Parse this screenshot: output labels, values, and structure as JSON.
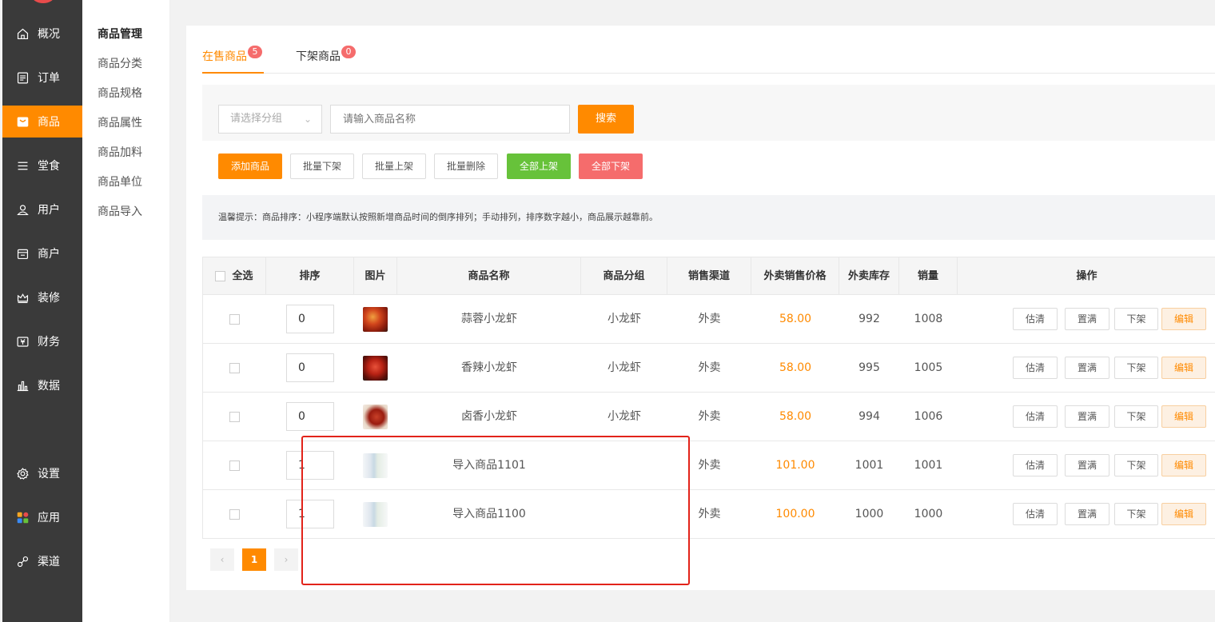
{
  "nav": {
    "items": [
      {
        "label": "概况",
        "icon": "home-icon"
      },
      {
        "label": "订单",
        "icon": "order-list-icon"
      },
      {
        "label": "商品",
        "icon": "shop-bag-icon"
      },
      {
        "label": "堂食",
        "icon": "menu-lines-icon"
      },
      {
        "label": "用户",
        "icon": "user-icon"
      },
      {
        "label": "商户",
        "icon": "store-icon"
      },
      {
        "label": "装修",
        "icon": "crown-icon"
      },
      {
        "label": "财务",
        "icon": "finance-icon"
      },
      {
        "label": "数据",
        "icon": "bar-chart-icon"
      },
      {
        "label": "设置",
        "icon": "gear-icon"
      },
      {
        "label": "应用",
        "icon": "apps-icon"
      },
      {
        "label": "渠道",
        "icon": "channel-icon"
      }
    ],
    "active": "商品",
    "accent": "#ff8a00"
  },
  "submenu": {
    "items": [
      "商品管理",
      "商品分类",
      "商品规格",
      "商品属性",
      "商品加料",
      "商品单位",
      "商品导入"
    ],
    "active": "商品管理"
  },
  "tabs": [
    {
      "label": "在售商品",
      "badge": "5",
      "active": true
    },
    {
      "label": "下架商品",
      "badge": "0",
      "active": false
    }
  ],
  "filter": {
    "group_placeholder": "请选择分组",
    "name_placeholder": "请输入商品名称",
    "search_label": "搜索"
  },
  "actions": {
    "add": "添加商品",
    "batch_off": "批量下架",
    "batch_on": "批量上架",
    "batch_delete": "批量删除",
    "all_on": "全部上架",
    "all_off": "全部下架"
  },
  "tip": "温馨提示：商品排序：小程序端默认按照新增商品时间的倒序排列；手动排列，排序数字越小，商品展示越靠前。",
  "table": {
    "headers": {
      "select_all": "全选",
      "sort": "排序",
      "image": "图片",
      "name": "商品名称",
      "group": "商品分组",
      "channel": "销售渠道",
      "price": "外卖销售价格",
      "stock": "外卖库存",
      "sales": "销量",
      "ops": "操作"
    },
    "rows": [
      {
        "sort": "0",
        "image": "crayfish-garlic-photo",
        "name": "蒜蓉小龙虾",
        "group": "小龙虾",
        "channel": "外卖",
        "price": "58.00",
        "stock": "992",
        "sales": "1008"
      },
      {
        "sort": "0",
        "image": "crayfish-spicy-photo",
        "name": "香辣小龙虾",
        "group": "小龙虾",
        "channel": "外卖",
        "price": "58.00",
        "stock": "995",
        "sales": "1005"
      },
      {
        "sort": "0",
        "image": "crayfish-braised-photo",
        "name": "卤香小龙虾",
        "group": "小龙虾",
        "channel": "外卖",
        "price": "58.00",
        "stock": "994",
        "sales": "1006"
      },
      {
        "sort": "1",
        "image": "blurred-placeholder",
        "name": "导入商品1101",
        "group": "",
        "channel": "外卖",
        "price": "101.00",
        "stock": "1001",
        "sales": "1001"
      },
      {
        "sort": "1",
        "image": "blurred-placeholder",
        "name": "导入商品1100",
        "group": "",
        "channel": "外卖",
        "price": "100.00",
        "stock": "1000",
        "sales": "1000"
      }
    ],
    "row_ops": [
      "估清",
      "置满",
      "下架",
      "编辑"
    ]
  },
  "pager": {
    "prev": "‹",
    "current": "1",
    "next": "›"
  }
}
